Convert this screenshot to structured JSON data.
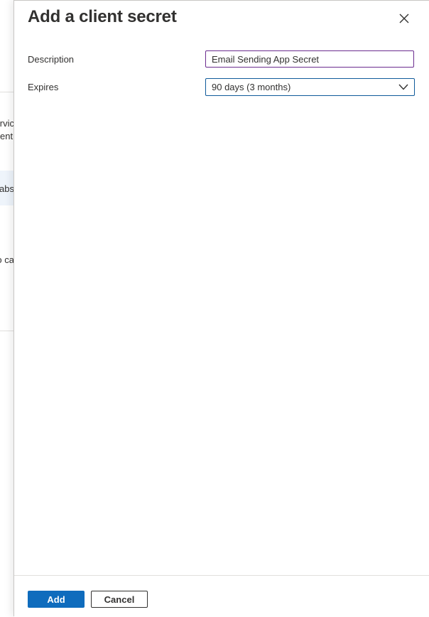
{
  "background": {
    "fragments": [
      "rvic",
      "ent",
      "abs",
      "o ca"
    ]
  },
  "panel": {
    "title": "Add a client secret",
    "close_icon": "close-icon",
    "description": {
      "label": "Description",
      "value": "Email Sending App Secret"
    },
    "expires": {
      "label": "Expires",
      "selected": "90 days (3 months)",
      "icon": "chevron-down-icon"
    }
  },
  "footer": {
    "add_label": "Add",
    "cancel_label": "Cancel"
  },
  "colors": {
    "primary": "#0f6cbd",
    "description_border": "#6b2c8f",
    "dropdown_border": "#0f5a9a",
    "text": "#323130"
  }
}
